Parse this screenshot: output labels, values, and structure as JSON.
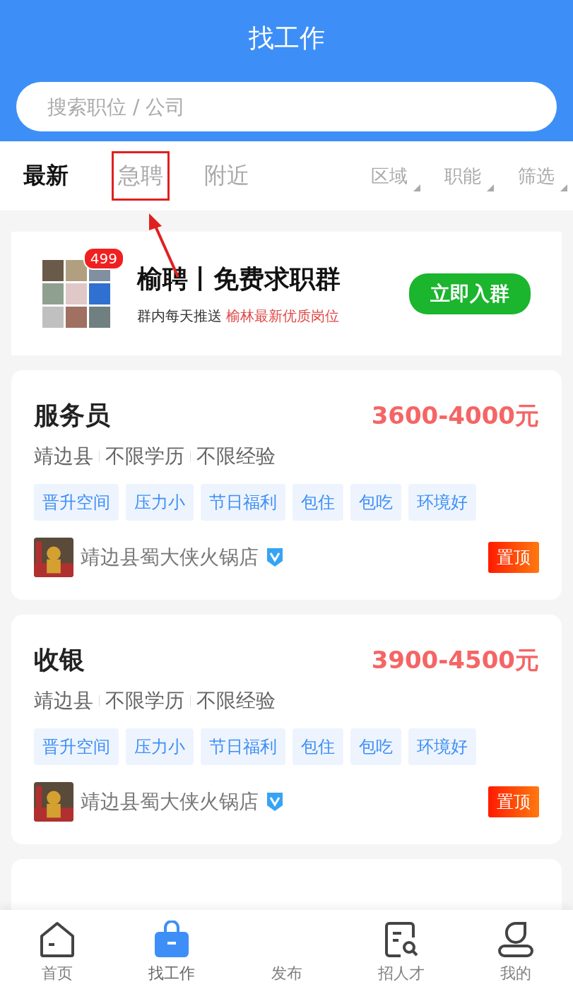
{
  "header": {
    "title": "找工作"
  },
  "search": {
    "placeholder": "搜索职位 / 公司"
  },
  "tabs": [
    {
      "label": "最新",
      "selected": true,
      "highlighted": false
    },
    {
      "label": "急聘",
      "selected": false,
      "highlighted": true
    },
    {
      "label": "附近",
      "selected": false,
      "highlighted": false
    }
  ],
  "filters": [
    "区域",
    "职能",
    "筛选"
  ],
  "banner": {
    "badge": "499",
    "title": "榆聘丨免费求职群",
    "subtitle": "群内每天推送 **榆林最新优质岗位**",
    "button": "立即入群"
  },
  "jobs": [
    {
      "title": "服务员",
      "salary": "3600-4000元",
      "meta": [
        "靖边县",
        "不限学历",
        "不限经验"
      ],
      "tags": [
        "晋升空间",
        "压力小",
        "节日福利",
        "包住",
        "包吃",
        "环境好"
      ],
      "company": "靖边县蜀大侠火锅店",
      "verified": true,
      "pinned": "置顶"
    },
    {
      "title": "收银",
      "salary": "3900-4500元",
      "meta": [
        "靖边县",
        "不限学历",
        "不限经验"
      ],
      "tags": [
        "晋升空间",
        "压力小",
        "节日福利",
        "包住",
        "包吃",
        "环境好"
      ],
      "company": "靖边县蜀大侠火锅店",
      "verified": true,
      "pinned": "置顶"
    }
  ],
  "nav": [
    {
      "label": "首页",
      "kind": "home",
      "selected": false
    },
    {
      "label": "找工作",
      "kind": "bag",
      "selected": true
    },
    {
      "label": "发布",
      "kind": "plain",
      "selected": false
    },
    {
      "label": "招人才",
      "kind": "doc",
      "selected": false
    },
    {
      "label": "我的",
      "kind": "user",
      "selected": false
    }
  ]
}
